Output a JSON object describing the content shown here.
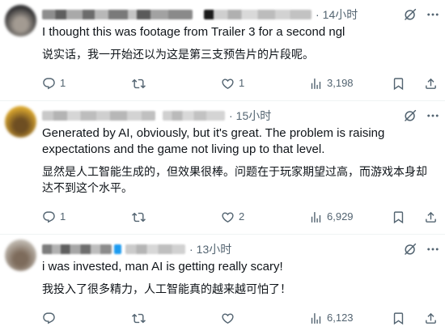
{
  "theme": {
    "text": "#0f1419",
    "muted": "#536471",
    "divider": "#eff3f4",
    "background": "#ffffff"
  },
  "icons": {
    "grok": "grok-icon",
    "more": "more-icon",
    "reply": "reply-icon",
    "retweet": "retweet-icon",
    "like": "like-icon",
    "views": "views-icon",
    "bookmark": "bookmark-icon",
    "share": "share-icon"
  },
  "separator": "·",
  "replies": [
    {
      "avatar": {
        "primary": "#2e2e30",
        "secondary": "#a39b92"
      },
      "time": "14小时",
      "text": "I thought this was footage from Trailer 3 for a second ngl",
      "translation": "说实话，我一开始还以为这是第三支预告片的片段呢。",
      "counts": {
        "replies": "1",
        "likes": "1",
        "views": "3,198"
      }
    },
    {
      "avatar": {
        "primary": "#d9a62e",
        "secondary": "#6e4e22"
      },
      "time": "15小时",
      "text": "Generated by AI, obviously, but it's great. The problem is raising expectations and the game not living up to that level.",
      "translation": "显然是人工智能生成的，但效果很棒。问题在于玩家期望过高，而游戏本身却达不到这个水平。",
      "counts": {
        "replies": "1",
        "likes": "2",
        "views": "6,929"
      }
    },
    {
      "avatar": {
        "primary": "#bdb6ad",
        "secondary": "#7d6b5b"
      },
      "time": "13小时",
      "text": "i was invested, man AI is getting really scary!",
      "translation": "我投入了很多精力，人工智能真的越来越可怕了！",
      "counts": {
        "views": "6,123"
      }
    }
  ]
}
